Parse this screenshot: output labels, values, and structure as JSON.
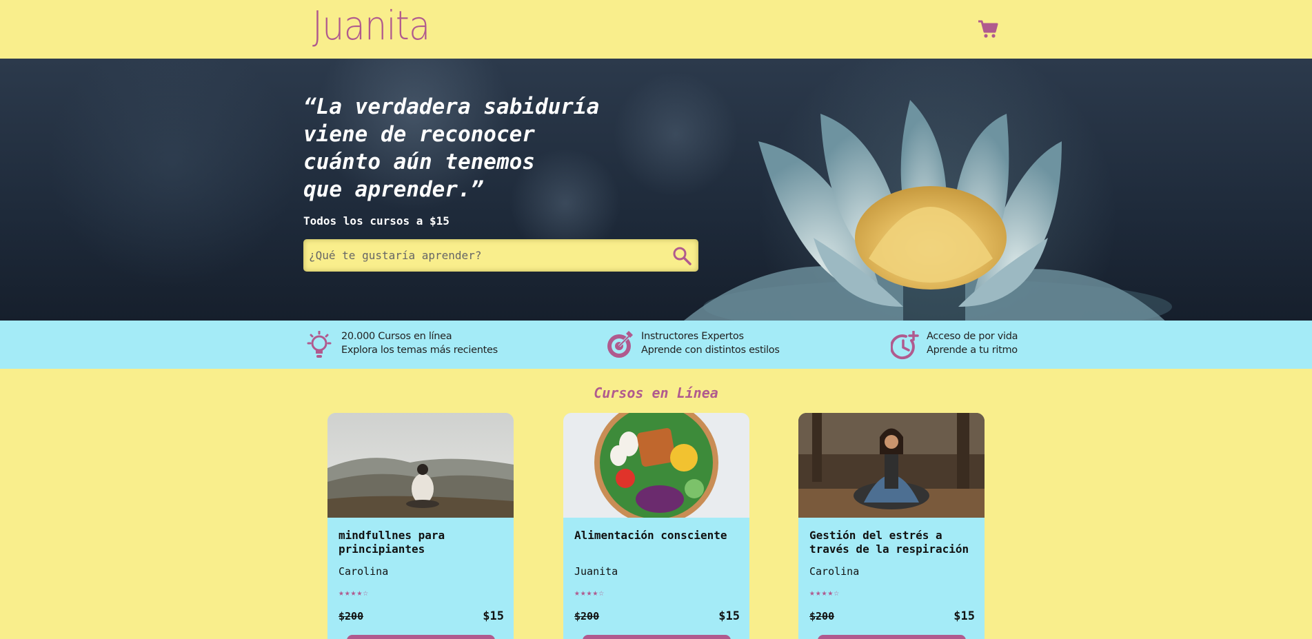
{
  "header": {
    "logo": "Juanita",
    "cart_icon": "shopping-cart-icon"
  },
  "hero": {
    "quote": "“La verdadera sabiduría\nviene de reconocer\ncuánto aún tenemos\nque aprender.”",
    "promo": "Todos los cursos a $15",
    "search": {
      "placeholder": "¿Qué te gustaría aprender?",
      "icon": "search-icon"
    }
  },
  "features": [
    {
      "icon": "lightbulb-icon",
      "line1": "20.000 Cursos en línea",
      "line2": "Explora los temas más recientes"
    },
    {
      "icon": "target-icon",
      "line1": "Instructores Expertos",
      "line2": "Aprende con distintos estilos"
    },
    {
      "icon": "clock-plus-icon",
      "line1": "Acceso de por vida",
      "line2": "Aprende a tu ritmo"
    }
  ],
  "section_title": "Cursos en Línea",
  "courses": [
    {
      "title": "mindfullnes para principiantes",
      "author": "Carolina",
      "stars": "★★★★☆",
      "old_price": "$200",
      "price": "$15"
    },
    {
      "title": "Alimentación consciente",
      "author": "Juanita",
      "stars": "★★★★☆",
      "old_price": "$200",
      "price": "$15"
    },
    {
      "title": "Gestión del estrés a través de la respiración",
      "author": "Carolina",
      "stars": "★★★★☆",
      "old_price": "$200",
      "price": "$15"
    }
  ],
  "colors": {
    "accent": "#b05a8e",
    "yellow": "#f9ee8c",
    "cyan": "#a4ebf7"
  }
}
